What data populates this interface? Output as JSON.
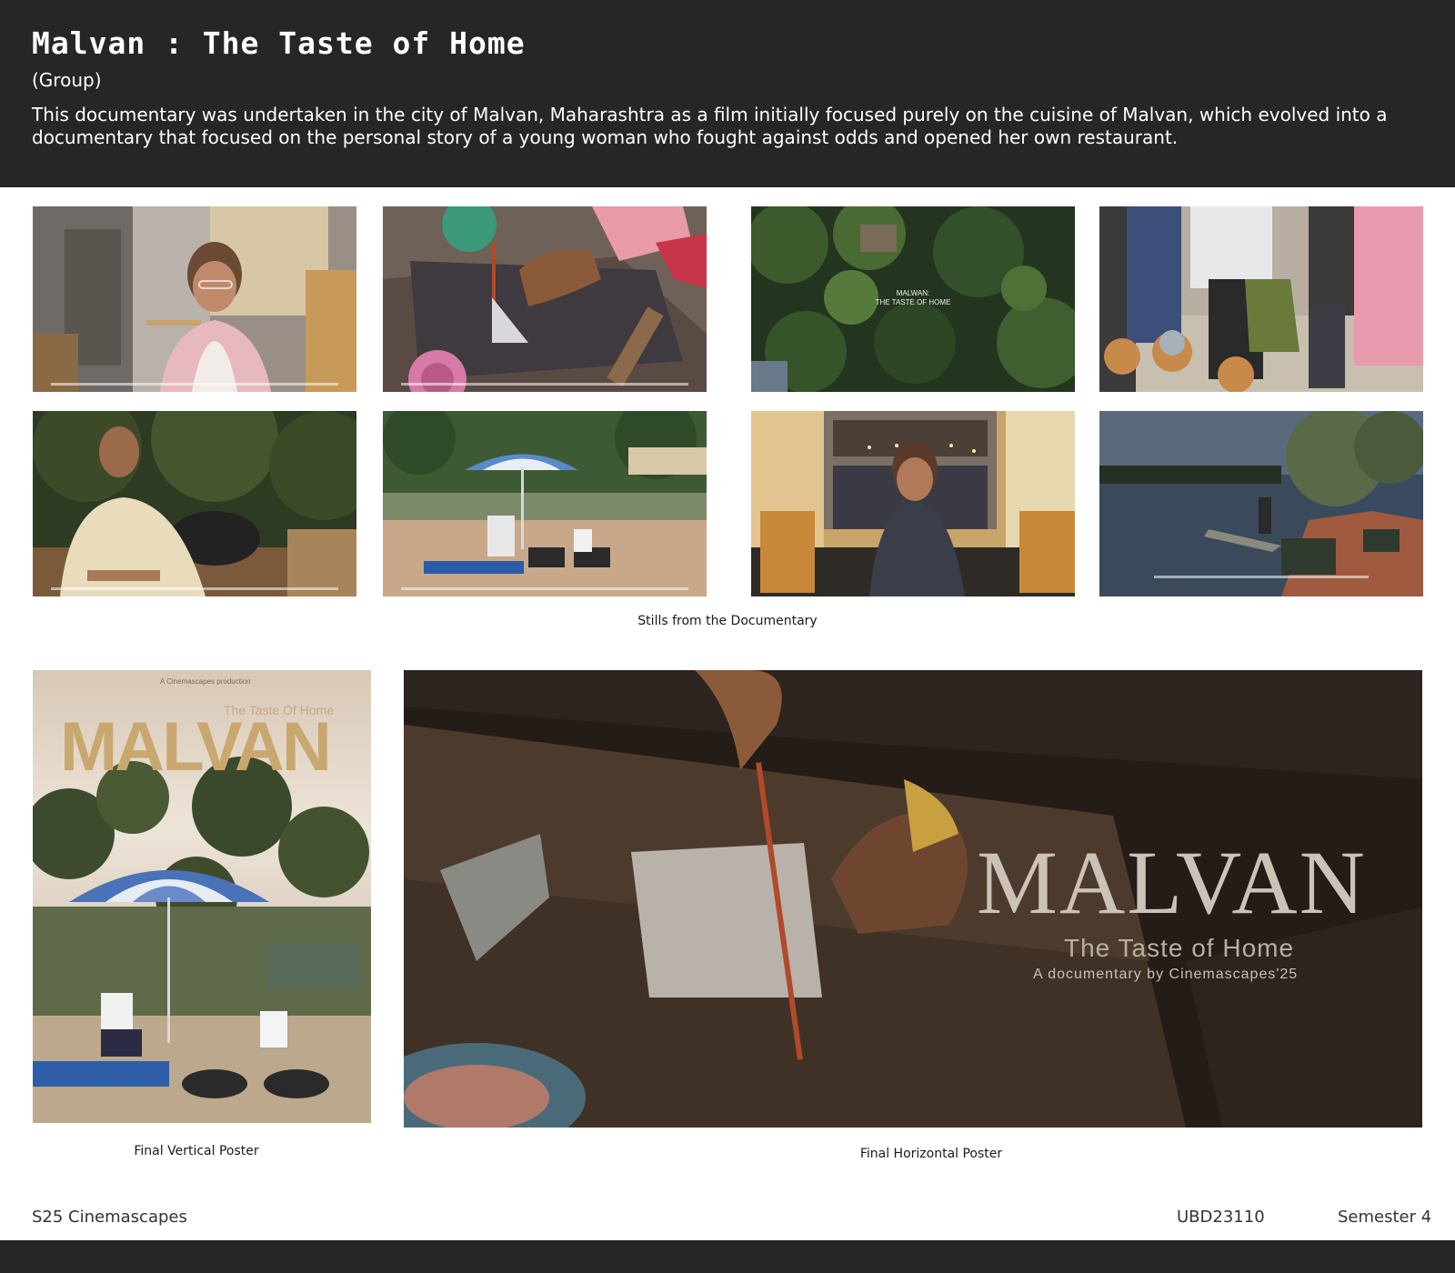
{
  "header": {
    "title": "Malvan : The Taste of Home",
    "subtitle": "(Group)",
    "description": "This documentary was undertaken in the city of Malvan, Maharashtra as a film initially focused purely on the cuisine of Malvan, which evolved into a documentary that focused on the personal story of a young woman who fought against odds and opened her own restaurant."
  },
  "stills": {
    "caption": "Stills from the Documentary",
    "aerial_title_line1": "MALWAN:",
    "aerial_title_line2": "THE TASTE OF HOME"
  },
  "posters": {
    "vertical_caption": "Final Vertical Poster",
    "horizontal_caption": "Final Horizontal Poster",
    "vertical": {
      "tagline": "The Taste Of Home",
      "title": "MALVAN",
      "production": "A Cinemascapes production"
    },
    "horizontal": {
      "title": "MALVAN",
      "tagline": "The Taste of Home",
      "credit": "A documentary by Cinemascapes'25"
    }
  },
  "footer": {
    "course": "S25 Cinemascapes",
    "code": "UBD23110",
    "semester": "Semester 4"
  }
}
